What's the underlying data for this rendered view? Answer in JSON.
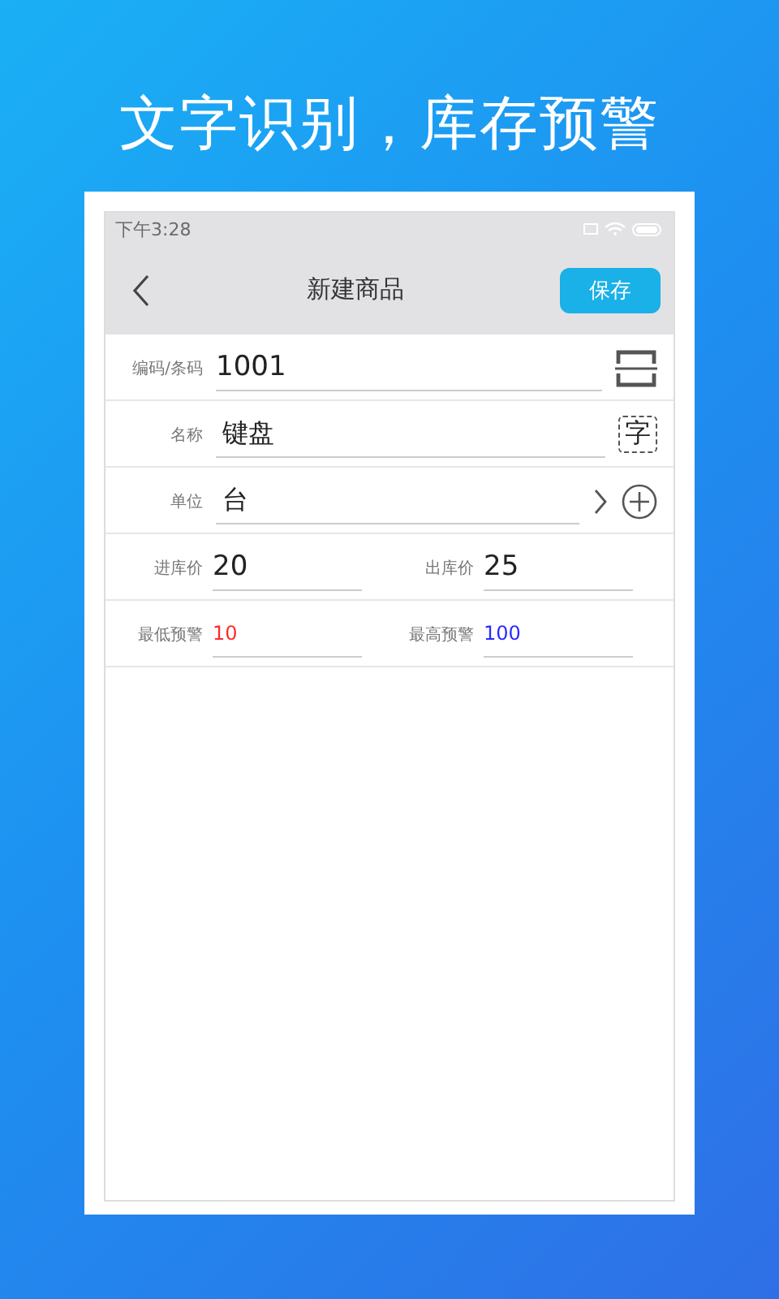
{
  "headline": "文字识别，库存预警",
  "status_bar": {
    "time": "下午3:28"
  },
  "header": {
    "title": "新建商品",
    "save_button": "保存"
  },
  "fields": [
    {
      "kind": "scan",
      "label": "编码/条码",
      "value": "1001"
    },
    {
      "kind": "ocr",
      "label": "名称",
      "value": "键盘",
      "icon_char": "字"
    },
    {
      "kind": "picker",
      "label": "单位",
      "value": "台"
    }
  ],
  "pairs": [
    [
      {
        "label": "进库价",
        "value": "20"
      },
      {
        "label": "出库价",
        "value": "25"
      }
    ],
    [
      {
        "label": "最低预警",
        "value": "10",
        "color": "#ff2a2a"
      },
      {
        "label": "最高预警",
        "value": "100",
        "color": "#2a2aff"
      }
    ]
  ]
}
